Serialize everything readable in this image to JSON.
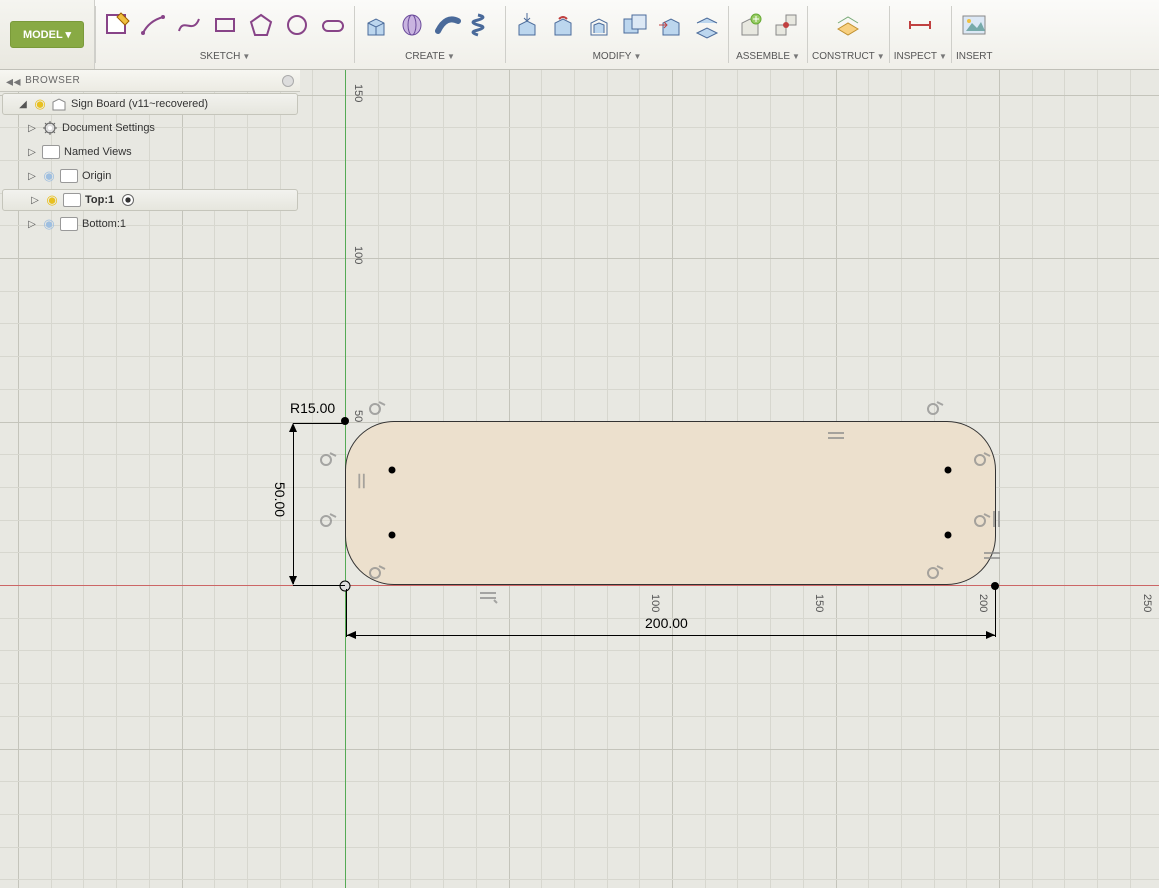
{
  "mode_button": "MODEL ▾",
  "toolbar_groups": {
    "sketch": "SKETCH",
    "create": "CREATE",
    "modify": "MODIFY",
    "assemble": "ASSEMBLE",
    "construct": "CONSTRUCT",
    "inspect": "INSPECT",
    "insert": "INSERT"
  },
  "browser_title": "BROWSER",
  "tree": {
    "root_label": "Sign Board (v11~recovered)",
    "items": [
      {
        "label": "Document Settings"
      },
      {
        "label": "Named Views"
      },
      {
        "label": "Origin"
      },
      {
        "label": "Top:1",
        "selected": true
      },
      {
        "label": "Bottom:1"
      }
    ]
  },
  "ruler_v": [
    "150",
    "100",
    "50"
  ],
  "ruler_h": [
    "100",
    "150",
    "200",
    "250"
  ],
  "dimensions": {
    "radius": "R15.00",
    "height": "50.00",
    "width": "200.00"
  },
  "colors": {
    "fill": "#ece0cd",
    "axis_h": "#cc6666",
    "axis_v": "#55aa55"
  }
}
